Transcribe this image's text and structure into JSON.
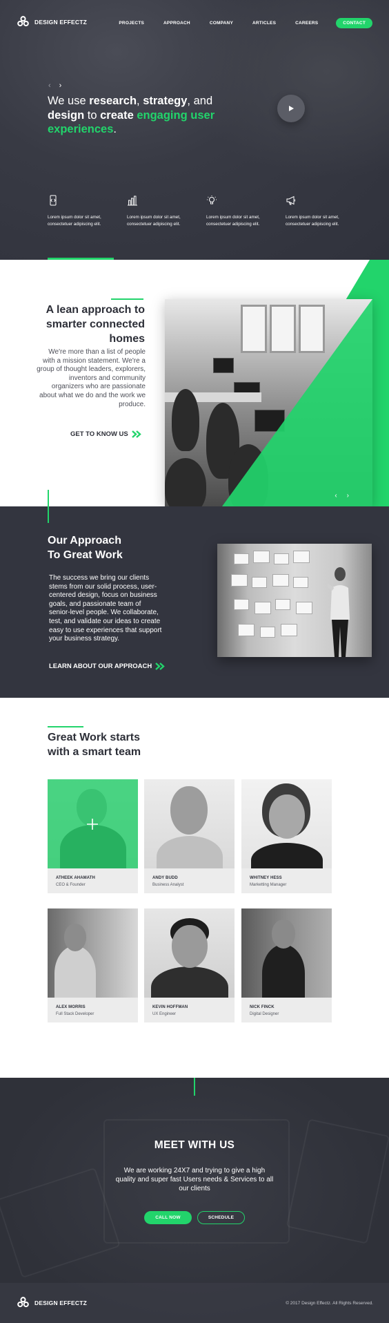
{
  "brand": {
    "name": "DESIGN EFFECTZ"
  },
  "nav": {
    "items": [
      "PROJECTS",
      "APPROACH",
      "COMPANY",
      "ARTICLES",
      "CAREERS"
    ],
    "contact_label": "CONTACT"
  },
  "hero": {
    "prev_arrow": "‹",
    "next_arrow": "›",
    "headline": {
      "p1": "We use ",
      "w1": "research",
      "p2": ", ",
      "w2": "strategy",
      "p3": ", and ",
      "w3": "design",
      "p4": " to ",
      "w4": "create",
      "p5": " ",
      "green": "engaging user experiences",
      "p6": "."
    },
    "features": [
      {
        "icon": "mobile-code-icon",
        "text": "Lorem ipsum dolor sit amet, consectetuer adipiscing elit."
      },
      {
        "icon": "bar-chart-icon",
        "text": "Lorem ipsum dolor sit amet, consectetuer adipiscing elit."
      },
      {
        "icon": "lightbulb-icon",
        "text": "Lorem ipsum dolor sit amet, consectetuer adipiscing elit."
      },
      {
        "icon": "megaphone-icon",
        "text": "Lorem ipsum dolor sit amet, consectetuer adipiscing elit."
      }
    ]
  },
  "lean": {
    "title": "A lean approach to smarter connected homes",
    "body": "We're more than a list of people with a mission statement. We're a group of thought leaders, explorers, inventors and community organizers who are passionate about what we do and the work we produce.",
    "cta": "GET TO KNOW US",
    "photo_prev": "‹",
    "photo_next": "›"
  },
  "approach": {
    "title_line1": "Our Approach",
    "title_line2": "To Great Work",
    "body": "The success we bring our clients stems from our solid process, user-centered design, focus on business goals, and passionate team of senior-level people. We collaborate, test, and validate our ideas to create easy to use experiences that support your business strategy.",
    "cta": "LEARN ABOUT OUR APPROACH"
  },
  "team": {
    "title_line1": "Great Work starts",
    "title_line2": "with a smart team",
    "members": [
      {
        "name": "ATHEEK AHAMATH",
        "role": "CEO & Founder"
      },
      {
        "name": "ANDY BUDD",
        "role": "Business Analyst"
      },
      {
        "name": "WHITNEY HESS",
        "role": "Marketting Manager"
      },
      {
        "name": "ALEX MORRIS",
        "role": "Full Stack Developer"
      },
      {
        "name": "KEVIN HOFFMAN",
        "role": "UX Engineer"
      },
      {
        "name": "NICK FINCK",
        "role": "Digital Designer"
      }
    ]
  },
  "meet": {
    "title": "MEET WITH US",
    "body": "We are working 24X7 and trying to give a high quality and super fast Users needs & Services to all our clients",
    "call_label": "CALL NOW",
    "schedule_label": "SCHEDULE"
  },
  "footer": {
    "copyright": "© 2017 Design Effectz. All Rights Reserved."
  },
  "colors": {
    "accent": "#22d46b",
    "dark": "#33353f",
    "text": "#2d2f38"
  }
}
